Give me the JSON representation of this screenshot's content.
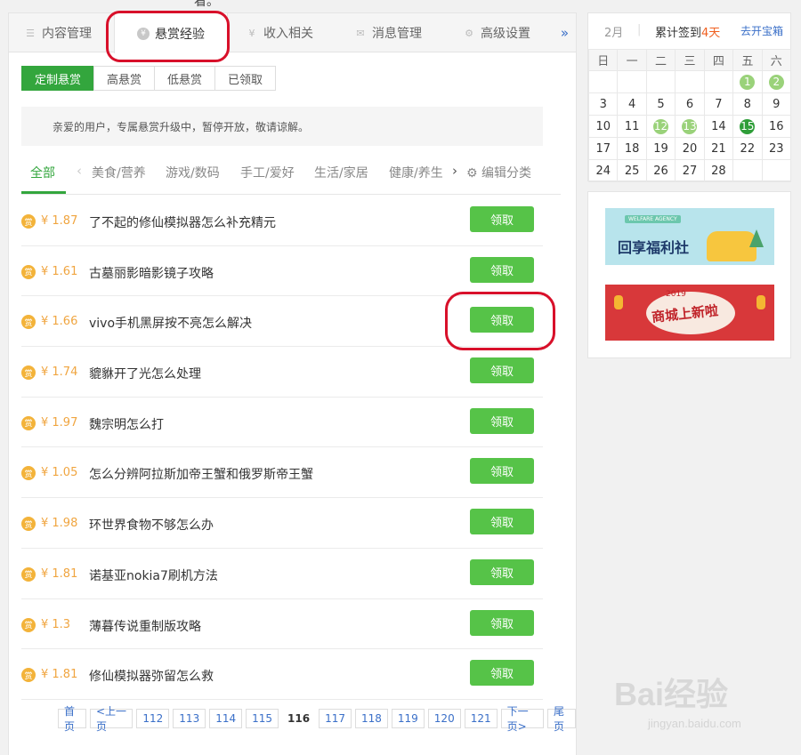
{
  "top_glyph": "看。",
  "tabs": [
    {
      "label": "内容管理",
      "icon": "list-icon"
    },
    {
      "label": "悬赏经验",
      "icon": "reward-coin-icon",
      "active": true
    },
    {
      "label": "收入相关",
      "icon": "yen-icon"
    },
    {
      "label": "消息管理",
      "icon": "mail-icon"
    },
    {
      "label": "高级设置",
      "icon": "gear-icon"
    }
  ],
  "tabs_more": "»",
  "filters": [
    "定制悬赏",
    "高悬赏",
    "低悬赏",
    "已领取"
  ],
  "notice": "亲爱的用户，专属悬赏升级中，暂停开放，敬请谅解。",
  "categories": {
    "all": "全部",
    "prev": "‹",
    "items": [
      "美食/营养",
      "游戏/数码",
      "手工/爱好",
      "生活/家居",
      "健康/养生"
    ],
    "next": "›",
    "edit": "编辑分类"
  },
  "coin_glyph": "赏",
  "claim_label": "领取",
  "questions": [
    {
      "price": "¥ 1.87",
      "title": "了不起的修仙模拟器怎么补充精元"
    },
    {
      "price": "¥ 1.61",
      "title": "古墓丽影暗影镜子攻略"
    },
    {
      "price": "¥ 1.66",
      "title": "vivo手机黑屏按不亮怎么解决"
    },
    {
      "price": "¥ 1.74",
      "title": "貔貅开了光怎么处理"
    },
    {
      "price": "¥ 1.97",
      "title": "魏宗明怎么打"
    },
    {
      "price": "¥ 1.05",
      "title": "怎么分辨阿拉斯加帝王蟹和俄罗斯帝王蟹"
    },
    {
      "price": "¥ 1.98",
      "title": "环世界食物不够怎么办"
    },
    {
      "price": "¥ 1.81",
      "title": "诺基亚nokia7刷机方法"
    },
    {
      "price": "¥ 1.3",
      "title": "薄暮传说重制版攻略"
    },
    {
      "price": "¥ 1.81",
      "title": "修仙模拟器弥留怎么救"
    }
  ],
  "pager": [
    "首页",
    "<上一页",
    "112",
    "113",
    "114",
    "115",
    "116",
    "117",
    "118",
    "119",
    "120",
    "121",
    "下一页>",
    "尾页"
  ],
  "pager_current": "116",
  "calendar": {
    "month": "2月",
    "sep": "|",
    "sign_prefix": "累计签到",
    "sign_days": "4天",
    "link": "去开宝箱",
    "weekdays": [
      "日",
      "一",
      "二",
      "三",
      "四",
      "五",
      "六"
    ],
    "weeks": [
      [
        "",
        "",
        "",
        "",
        "",
        "1",
        "2"
      ],
      [
        "3",
        "4",
        "5",
        "6",
        "7",
        "8",
        "9"
      ],
      [
        "10",
        "11",
        "12",
        "13",
        "14",
        "15",
        "16"
      ],
      [
        "17",
        "18",
        "19",
        "20",
        "21",
        "22",
        "23"
      ],
      [
        "24",
        "25",
        "26",
        "27",
        "28",
        "",
        ""
      ]
    ],
    "signed": [
      "1",
      "2",
      "12",
      "13"
    ],
    "today": "15"
  },
  "ads": {
    "ad1_tag": "WELFARE AGENCY",
    "ad1_text": "回享福利社",
    "ad2_year": "2019",
    "ad2_text": "商城上新啦"
  },
  "watermark": "Bai经验",
  "watermark_sub": "jingyan.baidu.com",
  "colors": {
    "accent": "#33a63d",
    "button": "#56c348",
    "price": "#f0a540",
    "annotation": "#d8102a",
    "link": "#3a6fc8"
  }
}
